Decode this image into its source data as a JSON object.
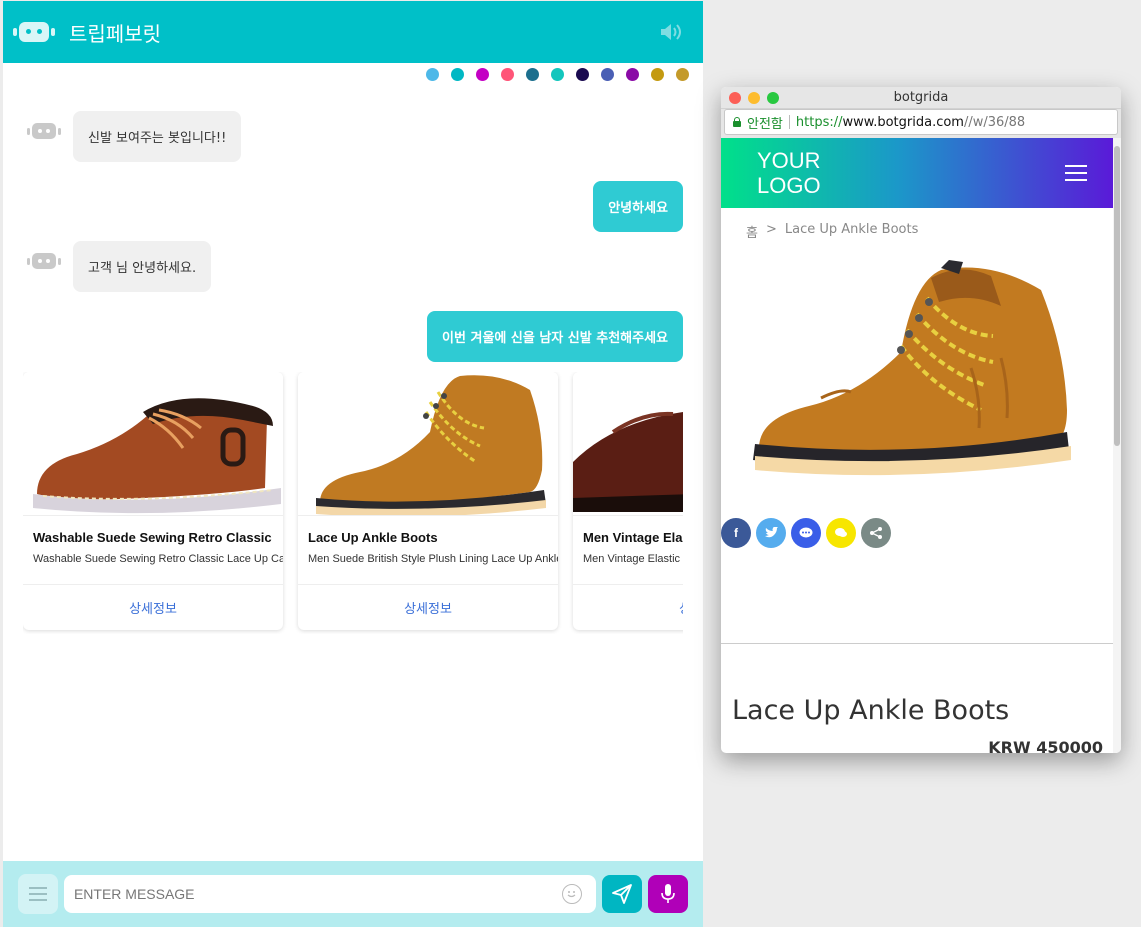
{
  "chat": {
    "title": "트립페보릿",
    "palette": [
      "#4db8e8",
      "#00b8c4",
      "#c400c4",
      "#ff5578",
      "#1c6f8e",
      "#13c6bd",
      "#1a0a50",
      "#4a5fb5",
      "#8a0aa6",
      "#c49a10",
      "#c49a2a"
    ],
    "messages": [
      {
        "from": "bot",
        "text": "신발 보여주는 봇입니다!!"
      },
      {
        "from": "user",
        "text": "안녕하세요"
      },
      {
        "from": "bot",
        "text": "고객 님 안녕하세요."
      },
      {
        "from": "user",
        "text": "이번 겨울에 신을 남자 신발 추천해주세요"
      }
    ],
    "cards": [
      {
        "title": "Washable Suede Sewing Retro Classic",
        "desc": "Washable Suede Sewing Retro Classic Lace Up Casual",
        "button": "상세정보"
      },
      {
        "title": "Lace Up Ankle Boots",
        "desc": "Men Suede British Style Plush Lining Lace Up Ankle",
        "button": "상세정보"
      },
      {
        "title": "Men Vintage Elastic",
        "desc": "Men Vintage Elastic",
        "button": "상세정보"
      }
    ],
    "input": {
      "placeholder": "ENTER MESSAGE",
      "value": ""
    }
  },
  "browser": {
    "window_title": "botgrida",
    "url": {
      "secure_label": "안전함",
      "scheme": "https://",
      "host": "www.botgrida.com",
      "path": "//w/36/88"
    },
    "site": {
      "logo_line1": "YOUR",
      "logo_line2": "LOGO",
      "breadcrumb_home": "홈",
      "breadcrumb_sep": ">",
      "breadcrumb_current": "Lace Up Ankle Boots",
      "share_icons": [
        "facebook-icon",
        "twitter-icon",
        "chat-icon",
        "kakao-icon",
        "share-icon"
      ],
      "share_colors": [
        "#3b5998",
        "#55acee",
        "#3a5ee8",
        "#f7e600",
        "#7a8a86"
      ],
      "product_name": "Lace Up Ankle Boots",
      "product_price": "KRW 450000"
    }
  }
}
